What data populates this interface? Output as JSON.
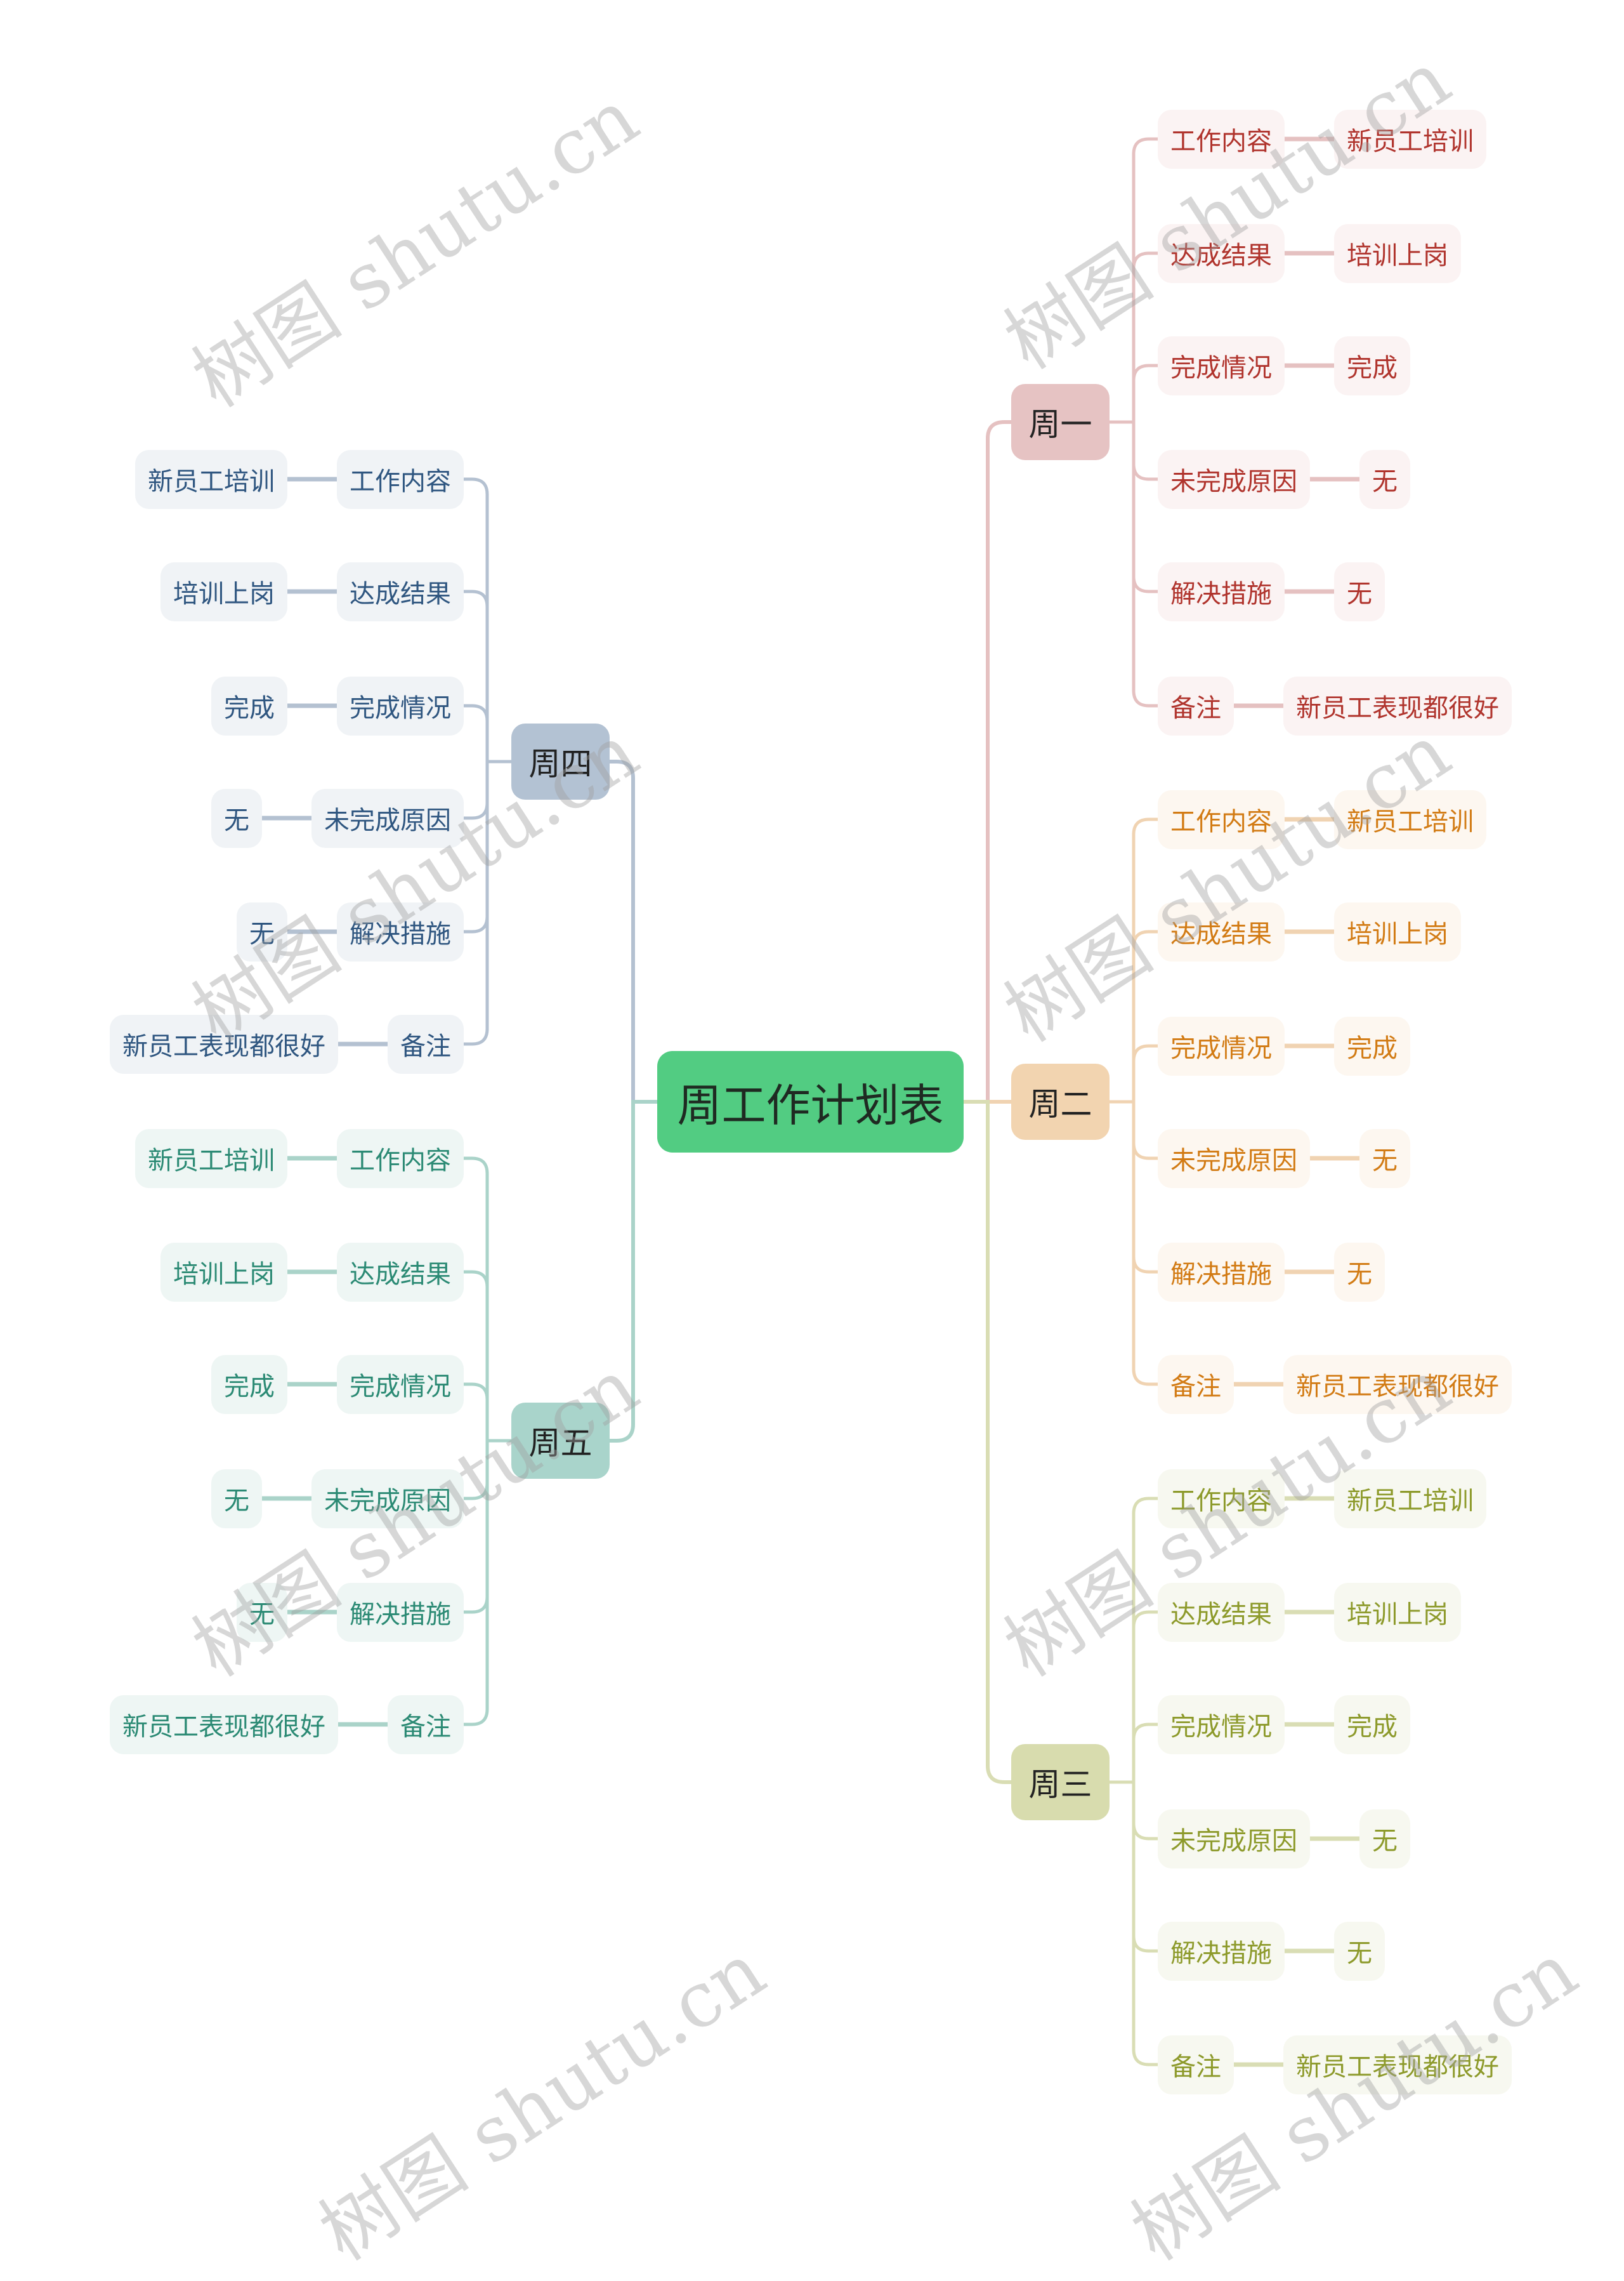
{
  "root": {
    "label": "周工作计划表",
    "color": "#52cc82"
  },
  "branches": [
    {
      "label": "周一",
      "side": "right",
      "bg": "#e6c3c3",
      "line": "#e5c1c1",
      "text": "#b0342d",
      "chip": "#fbf3f3",
      "items": [
        {
          "key": "工作内容",
          "value": "新员工培训"
        },
        {
          "key": "达成结果",
          "value": "培训上岗"
        },
        {
          "key": "完成情况",
          "value": "完成"
        },
        {
          "key": "未完成原因",
          "value": "无"
        },
        {
          "key": "解决措施",
          "value": "无"
        },
        {
          "key": "备注",
          "value": "新员工表现都很好"
        }
      ]
    },
    {
      "label": "周二",
      "side": "right",
      "bg": "#f2d4b0",
      "line": "#f0d3b2",
      "text": "#d27b14",
      "chip": "#fdf7f0",
      "items": [
        {
          "key": "工作内容",
          "value": "新员工培训"
        },
        {
          "key": "达成结果",
          "value": "培训上岗"
        },
        {
          "key": "完成情况",
          "value": "完成"
        },
        {
          "key": "未完成原因",
          "value": "无"
        },
        {
          "key": "解决措施",
          "value": "无"
        },
        {
          "key": "备注",
          "value": "新员工表现都很好"
        }
      ]
    },
    {
      "label": "周三",
      "side": "right",
      "bg": "#d8dcae",
      "line": "#d9ddb4",
      "text": "#8d9a2b",
      "chip": "#f7f8f0",
      "items": [
        {
          "key": "工作内容",
          "value": "新员工培训"
        },
        {
          "key": "达成结果",
          "value": "培训上岗"
        },
        {
          "key": "完成情况",
          "value": "完成"
        },
        {
          "key": "未完成原因",
          "value": "无"
        },
        {
          "key": "解决措施",
          "value": "无"
        },
        {
          "key": "备注",
          "value": "新员工表现都很好"
        }
      ]
    },
    {
      "label": "周四",
      "side": "left",
      "bg": "#b3c2d3",
      "line": "#b4c1d1",
      "text": "#2f5680",
      "chip": "#f0f3f6",
      "items": [
        {
          "key": "工作内容",
          "value": "新员工培训"
        },
        {
          "key": "达成结果",
          "value": "培训上岗"
        },
        {
          "key": "完成情况",
          "value": "完成"
        },
        {
          "key": "未完成原因",
          "value": "无"
        },
        {
          "key": "解决措施",
          "value": "无"
        },
        {
          "key": "备注",
          "value": "新员工表现都很好"
        }
      ]
    },
    {
      "label": "周五",
      "side": "left",
      "bg": "#a9d4cb",
      "line": "#aad3c9",
      "text": "#2b8a74",
      "chip": "#eef6f4",
      "items": [
        {
          "key": "工作内容",
          "value": "新员工培训"
        },
        {
          "key": "达成结果",
          "value": "培训上岗"
        },
        {
          "key": "完成情况",
          "value": "完成"
        },
        {
          "key": "未完成原因",
          "value": "无"
        },
        {
          "key": "解决措施",
          "value": "无"
        },
        {
          "key": "备注",
          "value": "新员工表现都很好"
        }
      ]
    }
  ],
  "watermark": {
    "text": "树图 shutu.cn"
  }
}
